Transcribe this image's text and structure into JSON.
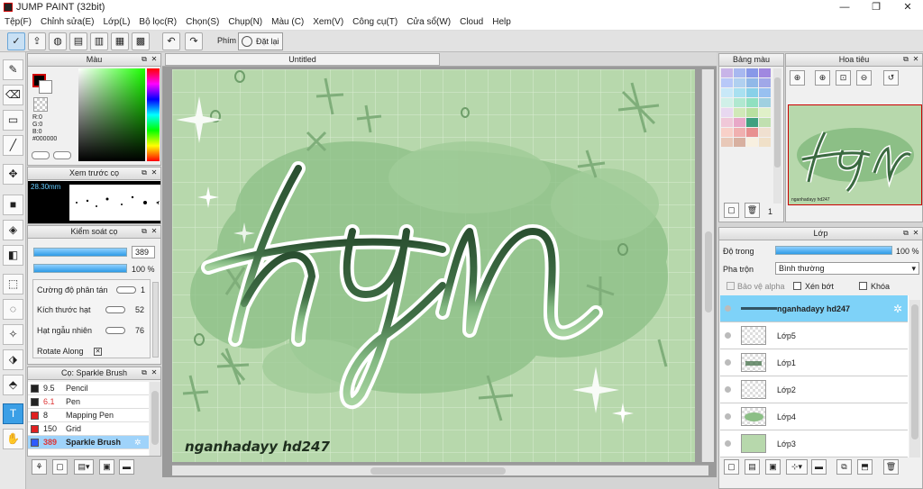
{
  "window": {
    "title": "JUMP PAINT (32bit)",
    "minimize": "—",
    "maximize": "❐",
    "close": "✕"
  },
  "menu": [
    "Tệp(F)",
    "Chỉnh sửa(E)",
    "Lớp(L)",
    "Bộ lọc(R)",
    "Chọn(S)",
    "Chụp(N)",
    "Màu (C)",
    "Xem(V)",
    "Công cụ(T)",
    "Cửa sổ(W)",
    "Cloud",
    "Help"
  ],
  "toolbar": {
    "phim_label": "Phím",
    "reset_label": "Đặt lại"
  },
  "color_panel": {
    "title": "Màu",
    "r": "R:0",
    "g": "G:0",
    "b": "B:0",
    "hex": "#000000"
  },
  "brush_preview": {
    "title": "Xem trước cọ",
    "size": "28.30mm"
  },
  "brush_control": {
    "title": "Kiểm soát cọ",
    "size": "389",
    "opacity": "100 %",
    "sliders": [
      {
        "label": "Cường độ phân tán",
        "value": "1"
      },
      {
        "label": "Kích thước hạt",
        "value": "52"
      },
      {
        "label": "Hạt ngẫu nhiên",
        "value": "76"
      },
      {
        "label": "Rotate Along",
        "value": ""
      }
    ]
  },
  "brush_list": {
    "title": "Cọ: Sparkle Brush",
    "items": [
      {
        "size": "9.5",
        "name": "Pencil",
        "color": "#222222"
      },
      {
        "size": "6.1",
        "name": "Pen",
        "color": "#222222"
      },
      {
        "size": "8",
        "name": "Mapping Pen",
        "color": "#e02020"
      },
      {
        "size": "150",
        "name": "Grid",
        "color": "#e02020"
      },
      {
        "size": "389",
        "name": "Sparkle Brush",
        "color": "#2e5bff"
      }
    ]
  },
  "document": {
    "tab": "Untitled",
    "signature": "nganhadayy hd247",
    "lettering": "hyn"
  },
  "palette": {
    "title": "Bảng màu",
    "count": "1"
  },
  "navigator": {
    "title": "Hoa tiêu",
    "signature": "nganhadayy hd247"
  },
  "layers": {
    "title": "Lớp",
    "opacity_label": "Độ trong",
    "opacity": "100 %",
    "blend_label": "Pha trộn",
    "blend": "Bình thường",
    "protect_alpha": "Bảo vệ alpha",
    "clip": "Xén bớt",
    "lock": "Khóa",
    "items": [
      "nganhadayy hd247",
      "Lớp5",
      "Lớp1",
      "Lớp2",
      "Lớp4",
      "Lớp3"
    ]
  },
  "colors": {
    "accent": "#3b9fe6",
    "canvas_bg": "#b5d7ab",
    "ink_dark": "#2f5834",
    "ink_light": "#8cc08a"
  }
}
